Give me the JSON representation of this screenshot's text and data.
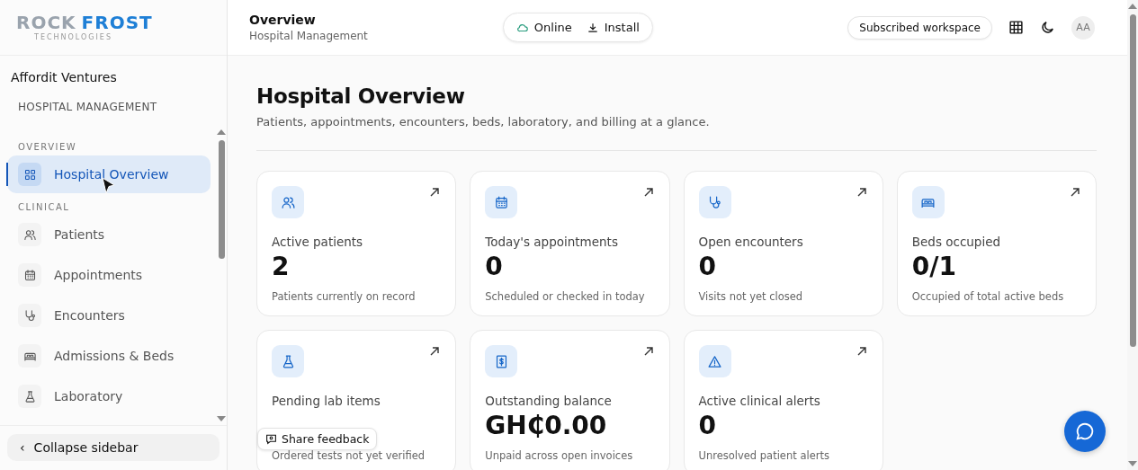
{
  "logo": {
    "word_1": "ROCK",
    "word_2": "FROST",
    "tagline": "TECHNOLOGIES"
  },
  "sidebar": {
    "organization": "Affordit Ventures",
    "module": "HOSPITAL MANAGEMENT",
    "sections": [
      {
        "title": "OVERVIEW",
        "items": [
          {
            "label": "Hospital Overview",
            "kind": "grid",
            "selected": true
          }
        ]
      },
      {
        "title": "CLINICAL",
        "items": [
          {
            "label": "Patients",
            "kind": "users",
            "selected": false
          },
          {
            "label": "Appointments",
            "kind": "calendar",
            "selected": false
          },
          {
            "label": "Encounters",
            "kind": "stethoscope",
            "selected": false
          },
          {
            "label": "Admissions & Beds",
            "kind": "bed",
            "selected": false
          },
          {
            "label": "Laboratory",
            "kind": "flask",
            "selected": false
          }
        ]
      }
    ],
    "collapse_button": {
      "icon": "‹",
      "label": "Collapse sidebar"
    }
  },
  "header": {
    "title": "Overview",
    "subtitle": "Hospital Management",
    "status": "Online",
    "install": "Install",
    "workspace": "Subscribed workspace",
    "avatar": "AA"
  },
  "page": {
    "title": "Hospital Overview",
    "subtitle": "Patients, appointments, encounters, beds, laboratory, and billing at a glance."
  },
  "cards": [
    {
      "kind": "users",
      "label": "Active patients",
      "value": "2",
      "caption": "Patients currently on record"
    },
    {
      "kind": "calendar",
      "label": "Today's appointments",
      "value": "0",
      "caption": "Scheduled or checked in today"
    },
    {
      "kind": "stethoscope",
      "label": "Open encounters",
      "value": "0",
      "caption": "Visits not yet closed"
    },
    {
      "kind": "bed",
      "label": "Beds occupied",
      "value": "0/1",
      "caption": "Occupied of total active beds"
    },
    {
      "kind": "flask",
      "label": "Pending lab items",
      "caption": "Ordered tests not yet verified"
    },
    {
      "kind": "dollar",
      "label": "Outstanding balance",
      "value": "GH₵0.00",
      "caption": "Unpaid across open invoices"
    },
    {
      "kind": "alert",
      "label": "Active clinical alerts",
      "value": "0",
      "caption": "Unresolved patient alerts"
    }
  ],
  "feedback_button": "Share feedback"
}
